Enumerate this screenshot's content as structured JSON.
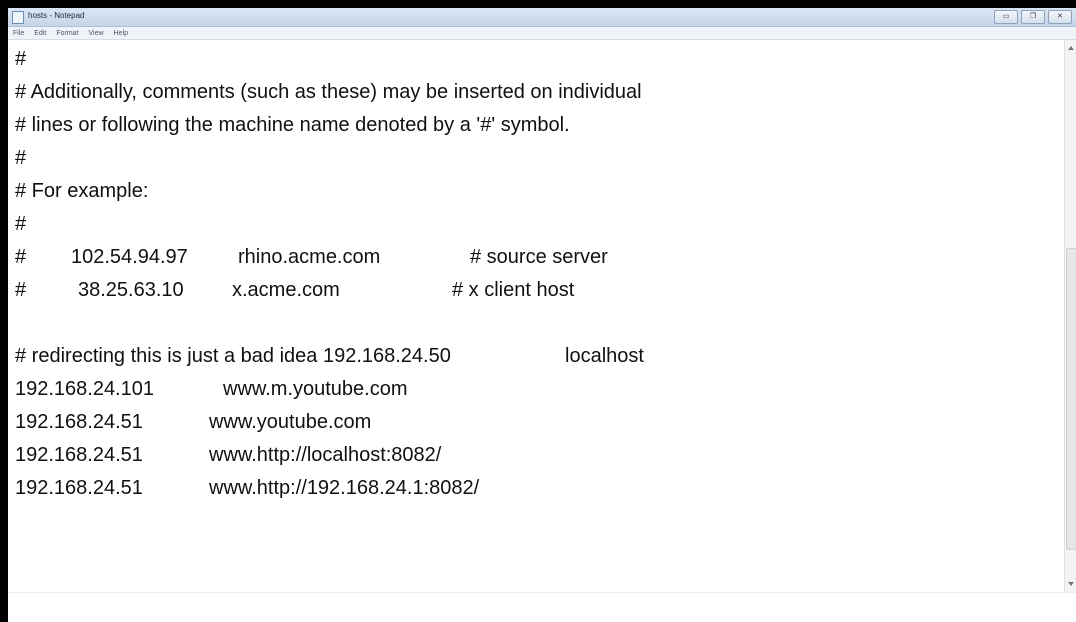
{
  "window": {
    "title": "hosts - Notepad",
    "controls": {
      "minimize": "▭",
      "restore": "❐",
      "close": "✕"
    }
  },
  "menu": [
    "File",
    "Edit",
    "Format",
    "View",
    "Help"
  ],
  "editor": {
    "lines": [
      "#",
      "# Additionally, comments (such as these) may be inserted on individual",
      "# lines or following the machine name denoted by a '#' symbol.",
      "#",
      "# For example:",
      "#",
      {
        "hash": "#",
        "ip": "102.54.94.97",
        "host": "rhino.acme.com",
        "comment": "# source server"
      },
      {
        "hash": "#",
        "ip": "38.25.63.10",
        "host": "x.acme.com",
        "comment": "# x client host"
      },
      "",
      {
        "text": "# redirecting this is just a bad idea 192.168.24.50",
        "host": "localhost"
      },
      {
        "ip": "192.168.24.101",
        "host": "www.m.youtube.com"
      },
      {
        "ip": "192.168.24.51",
        "host": "www.youtube.com"
      },
      {
        "ip": "192.168.24.51",
        "host": "www.http://localhost:8082/"
      },
      {
        "ip": "192.168.24.51",
        "host": "www.http://192.168.24.1:8082/"
      }
    ]
  },
  "icons": {
    "app": "notepad-icon",
    "scroll_up": "arrow-up-icon",
    "scroll_down": "arrow-down-icon"
  }
}
